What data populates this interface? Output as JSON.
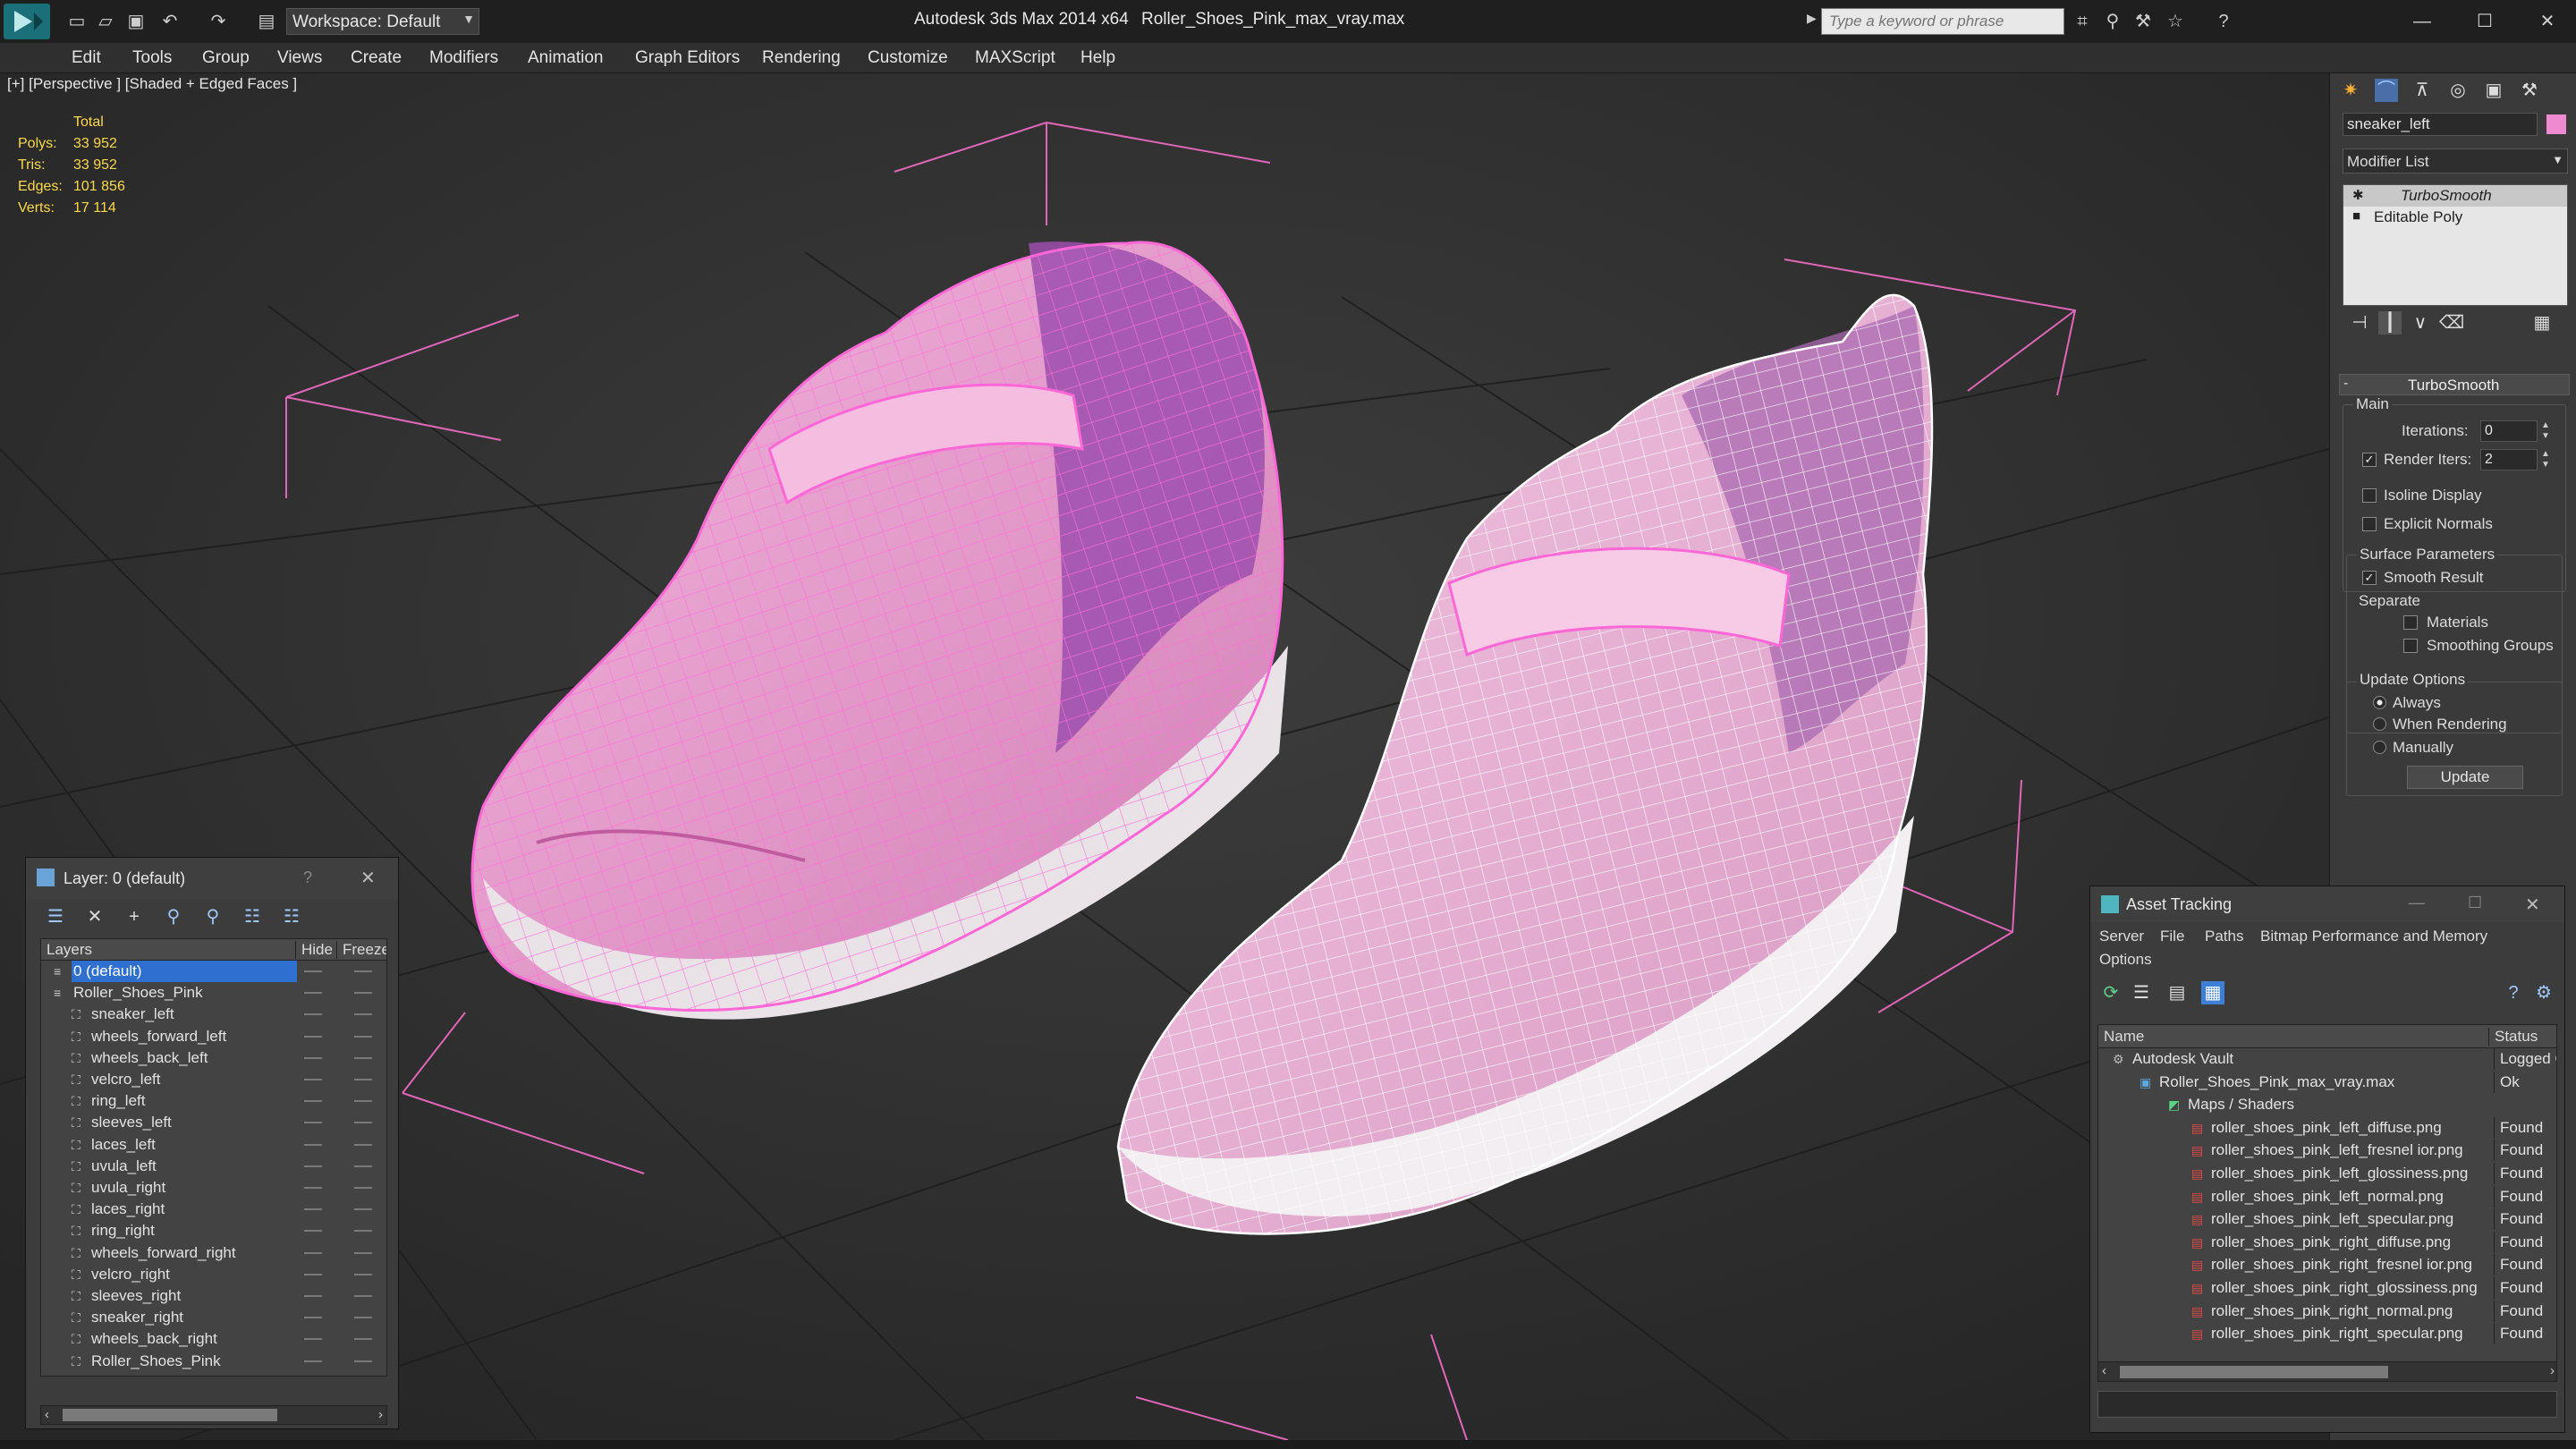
{
  "app": {
    "title": "Autodesk 3ds Max 2014 x64",
    "file": "Roller_Shoes_Pink_max_vray.max",
    "workspace": "Workspace: Default",
    "search_placeholder": "Type a keyword or phrase",
    "accent": "#3d7fd6"
  },
  "menu": [
    "Edit",
    "Tools",
    "Group",
    "Views",
    "Create",
    "Modifiers",
    "Animation",
    "Graph Editors",
    "Rendering",
    "Customize",
    "MAXScript",
    "Help"
  ],
  "viewport": {
    "label": "[+] [Perspective ] [Shaded + Edged Faces ]",
    "stats": {
      "header": "Total",
      "rows": [
        {
          "label": "Polys:",
          "value": "33 952"
        },
        {
          "label": "Tris:",
          "value": "33 952"
        },
        {
          "label": "Edges:",
          "value": "101 856"
        },
        {
          "label": "Verts:",
          "value": "17 114"
        }
      ]
    }
  },
  "command_panel": {
    "object_name": "sneaker_left",
    "object_color": "#f08ad0",
    "modifier_list": "Modifier List",
    "stack": [
      "TurboSmooth",
      "Editable Poly"
    ],
    "rollout": "TurboSmooth",
    "main_group": "Main",
    "iterations_label": "Iterations:",
    "iterations_value": "0",
    "render_iters_label": "Render Iters:",
    "render_iters_value": "2",
    "isoline": "Isoline Display",
    "explicit": "Explicit Normals",
    "surface_group": "Surface Parameters",
    "smooth_result": "Smooth Result",
    "separate": "Separate",
    "materials": "Materials",
    "smoothing_groups": "Smoothing Groups",
    "update_group": "Update Options",
    "always": "Always",
    "when_rendering": "When Rendering",
    "manually": "Manually",
    "update_button": "Update"
  },
  "layer_panel": {
    "title": "Layer: 0 (default)",
    "help": "?",
    "col_layers": "Layers",
    "col_hide": "Hide",
    "col_freeze": "Freeze",
    "rows": [
      {
        "name": "0 (default)",
        "level": 0,
        "selected": true
      },
      {
        "name": "Roller_Shoes_Pink",
        "level": 0,
        "selected": false
      },
      {
        "name": "sneaker_left",
        "level": 1
      },
      {
        "name": "wheels_forward_left",
        "level": 1
      },
      {
        "name": "wheels_back_left",
        "level": 1
      },
      {
        "name": "velcro_left",
        "level": 1
      },
      {
        "name": "ring_left",
        "level": 1
      },
      {
        "name": "sleeves_left",
        "level": 1
      },
      {
        "name": "laces_left",
        "level": 1
      },
      {
        "name": "uvula_left",
        "level": 1
      },
      {
        "name": "uvula_right",
        "level": 1
      },
      {
        "name": "laces_right",
        "level": 1
      },
      {
        "name": "ring_right",
        "level": 1
      },
      {
        "name": "wheels_forward_right",
        "level": 1
      },
      {
        "name": "velcro_right",
        "level": 1
      },
      {
        "name": "sleeves_right",
        "level": 1
      },
      {
        "name": "sneaker_right",
        "level": 1
      },
      {
        "name": "wheels_back_right",
        "level": 1
      },
      {
        "name": "Roller_Shoes_Pink",
        "level": 1
      }
    ]
  },
  "asset_panel": {
    "title": "Asset Tracking",
    "menu": [
      "Server",
      "File",
      "Paths",
      "Bitmap Performance and Memory"
    ],
    "menu2": "Options",
    "col_name": "Name",
    "col_status": "Status",
    "rows": [
      {
        "name": "Autodesk Vault",
        "status": "Logged O",
        "level": 0
      },
      {
        "name": "Roller_Shoes_Pink_max_vray.max",
        "status": "Ok",
        "level": 1
      },
      {
        "name": "Maps / Shaders",
        "status": "",
        "level": 2
      },
      {
        "name": "roller_shoes_pink_left_diffuse.png",
        "status": "Found",
        "level": 3
      },
      {
        "name": "roller_shoes_pink_left_fresnel ior.png",
        "status": "Found",
        "level": 3
      },
      {
        "name": "roller_shoes_pink_left_glossiness.png",
        "status": "Found",
        "level": 3
      },
      {
        "name": "roller_shoes_pink_left_normal.png",
        "status": "Found",
        "level": 3
      },
      {
        "name": "roller_shoes_pink_left_specular.png",
        "status": "Found",
        "level": 3
      },
      {
        "name": "roller_shoes_pink_right_diffuse.png",
        "status": "Found",
        "level": 3
      },
      {
        "name": "roller_shoes_pink_right_fresnel ior.png",
        "status": "Found",
        "level": 3
      },
      {
        "name": "roller_shoes_pink_right_glossiness.png",
        "status": "Found",
        "level": 3
      },
      {
        "name": "roller_shoes_pink_right_normal.png",
        "status": "Found",
        "level": 3
      },
      {
        "name": "roller_shoes_pink_right_specular.png",
        "status": "Found",
        "level": 3
      }
    ]
  }
}
